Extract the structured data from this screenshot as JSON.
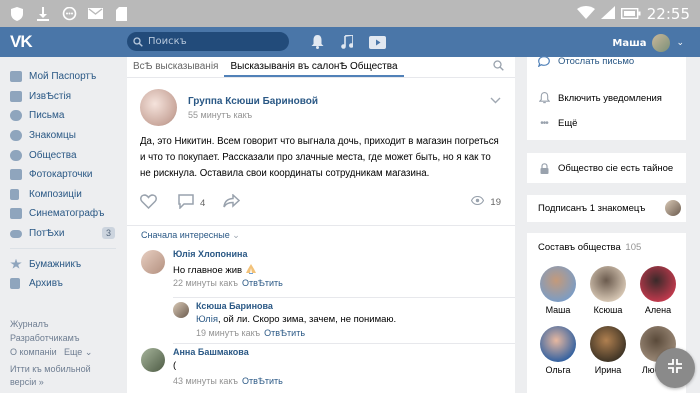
{
  "statusbar": {
    "time": "22:55"
  },
  "header": {
    "logo": "VK",
    "search_placeholder": "Поискъ",
    "user_name": "Маша"
  },
  "sidebar": {
    "items": [
      {
        "label": "Мой Паспортъ",
        "icon": "home-icon"
      },
      {
        "label": "ИзвѢстія",
        "icon": "news-icon"
      },
      {
        "label": "Письма",
        "icon": "message-icon"
      },
      {
        "label": "Знакомцы",
        "icon": "friends-icon"
      },
      {
        "label": "Общества",
        "icon": "groups-icon"
      },
      {
        "label": "Фотокарточки",
        "icon": "camera-icon"
      },
      {
        "label": "Композиціи",
        "icon": "music-icon"
      },
      {
        "label": "Синематографъ",
        "icon": "film-icon"
      },
      {
        "label": "ПотѢхи",
        "icon": "gamepad-icon",
        "badge": "3"
      },
      {
        "label": "Бумажникъ",
        "icon": "star-icon"
      },
      {
        "label": "Архивъ",
        "icon": "archive-icon"
      }
    ],
    "footer": {
      "journal": "Журналъ",
      "developers": "Разработчикамъ",
      "about": "О компаніи",
      "more": "Еще",
      "mobile": "Итти къ мобильной версіи »"
    }
  },
  "tabs": {
    "all": "ВсѢ высказыванія",
    "active": "Высказыванія въ салонѢ Общества"
  },
  "post": {
    "group_name": "Группа Ксюши Бариновой",
    "time": "55 минутъ какъ",
    "text": "Да, это Никитин. Всем говорит что выгнала дочь, приходит в магазин погреться и что то покупает. Рассказали про злачные места, где может быть, но я как то не рискнула. Оставила свои координаты сотрудникам магазина.",
    "comments_count": "4",
    "views": "19"
  },
  "comments": {
    "sort_label": "Сначала интересные",
    "reply_label": "ОтвѢтить",
    "items": [
      {
        "name": "Юлія Хлопонина",
        "text": "Но главное жив",
        "time": "22 минуты какъ"
      },
      {
        "name": "Ксюша Баринова",
        "mention": "Юлія",
        "text": ", ой ли. Скоро зима, зачем, не понимаю.",
        "time": "19 минутъ какъ"
      },
      {
        "name": "Анна Башмакова",
        "text": "(",
        "time": "43 минуты какъ"
      }
    ]
  },
  "right": {
    "send_letter": "Отослать письмо",
    "notify": "Включить уведомления",
    "more": "Ещё",
    "secret": "Общество сіе есть тайное",
    "subscribed": "Подписанъ 1 знакомецъ",
    "members_title": "Составъ общества",
    "members_count": "105",
    "members": [
      {
        "name": "Маша",
        "colors": [
          "#7a9cc6",
          "#c49a7a"
        ]
      },
      {
        "name": "Ксюша",
        "colors": [
          "#d9c9b6",
          "#6b5b4e"
        ]
      },
      {
        "name": "Алена",
        "colors": [
          "#c43a4e",
          "#3a2a2a"
        ]
      },
      {
        "name": "Ольга",
        "colors": [
          "#2f5fa0",
          "#e7b8a0"
        ]
      },
      {
        "name": "Ирина",
        "colors": [
          "#3c3224",
          "#b08050"
        ]
      },
      {
        "name": "Любовь",
        "colors": [
          "#9c8a78",
          "#5a4a3a"
        ]
      }
    ]
  },
  "colors": {
    "header": "#4a76a8",
    "link": "#2a5885",
    "bg": "#edeef0"
  }
}
